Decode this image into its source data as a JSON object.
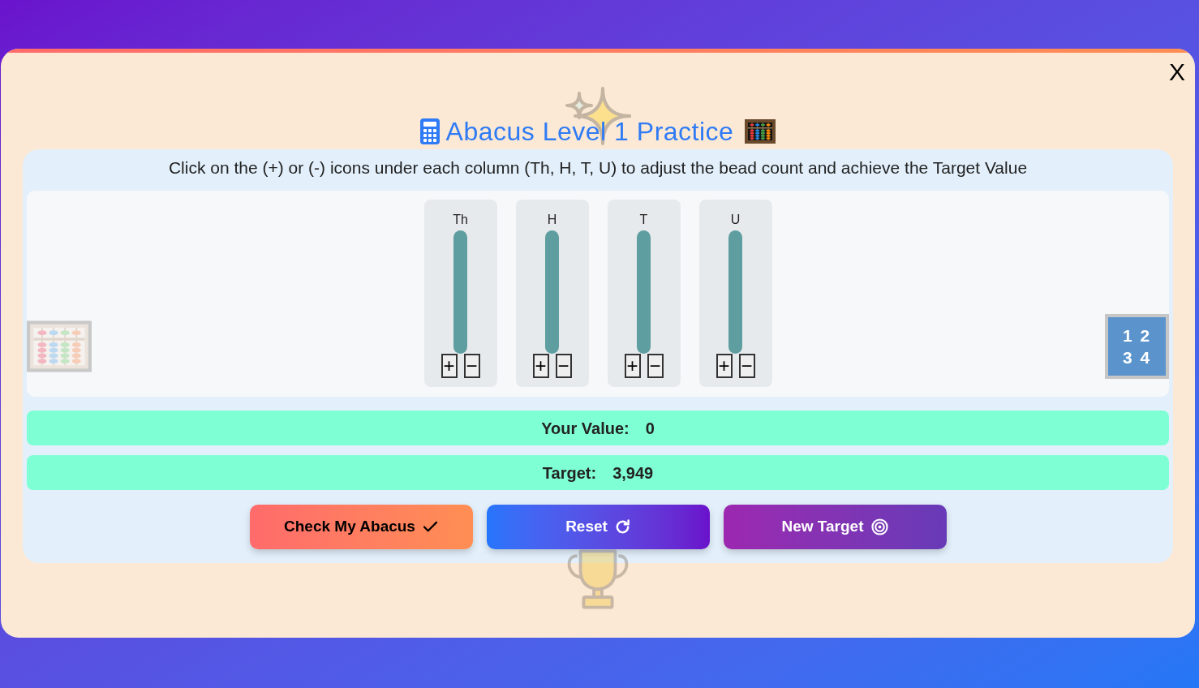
{
  "close_button": {
    "label": "X"
  },
  "title": "Abacus Level 1 Practice",
  "instructions": "Click on the (+) or (-) icons under each column (Th, H, T, U) to adjust the bead count and achieve the Target Value",
  "columns": [
    {
      "label": "Th",
      "increment": "+",
      "decrement": "−"
    },
    {
      "label": "H",
      "increment": "+",
      "decrement": "−"
    },
    {
      "label": "T",
      "increment": "+",
      "decrement": "−"
    },
    {
      "label": "U",
      "increment": "+",
      "decrement": "−"
    }
  ],
  "number_tile": {
    "lines": [
      "1 2",
      "3 4"
    ]
  },
  "readouts": [
    {
      "label": "Your Value:",
      "value": "0"
    },
    {
      "label": "Target:",
      "value": "3,949"
    }
  ],
  "buttons": [
    {
      "label": "Check My Abacus",
      "kind": "check"
    },
    {
      "label": "Reset",
      "kind": "reset"
    },
    {
      "label": "New Target",
      "kind": "new_target"
    }
  ]
}
